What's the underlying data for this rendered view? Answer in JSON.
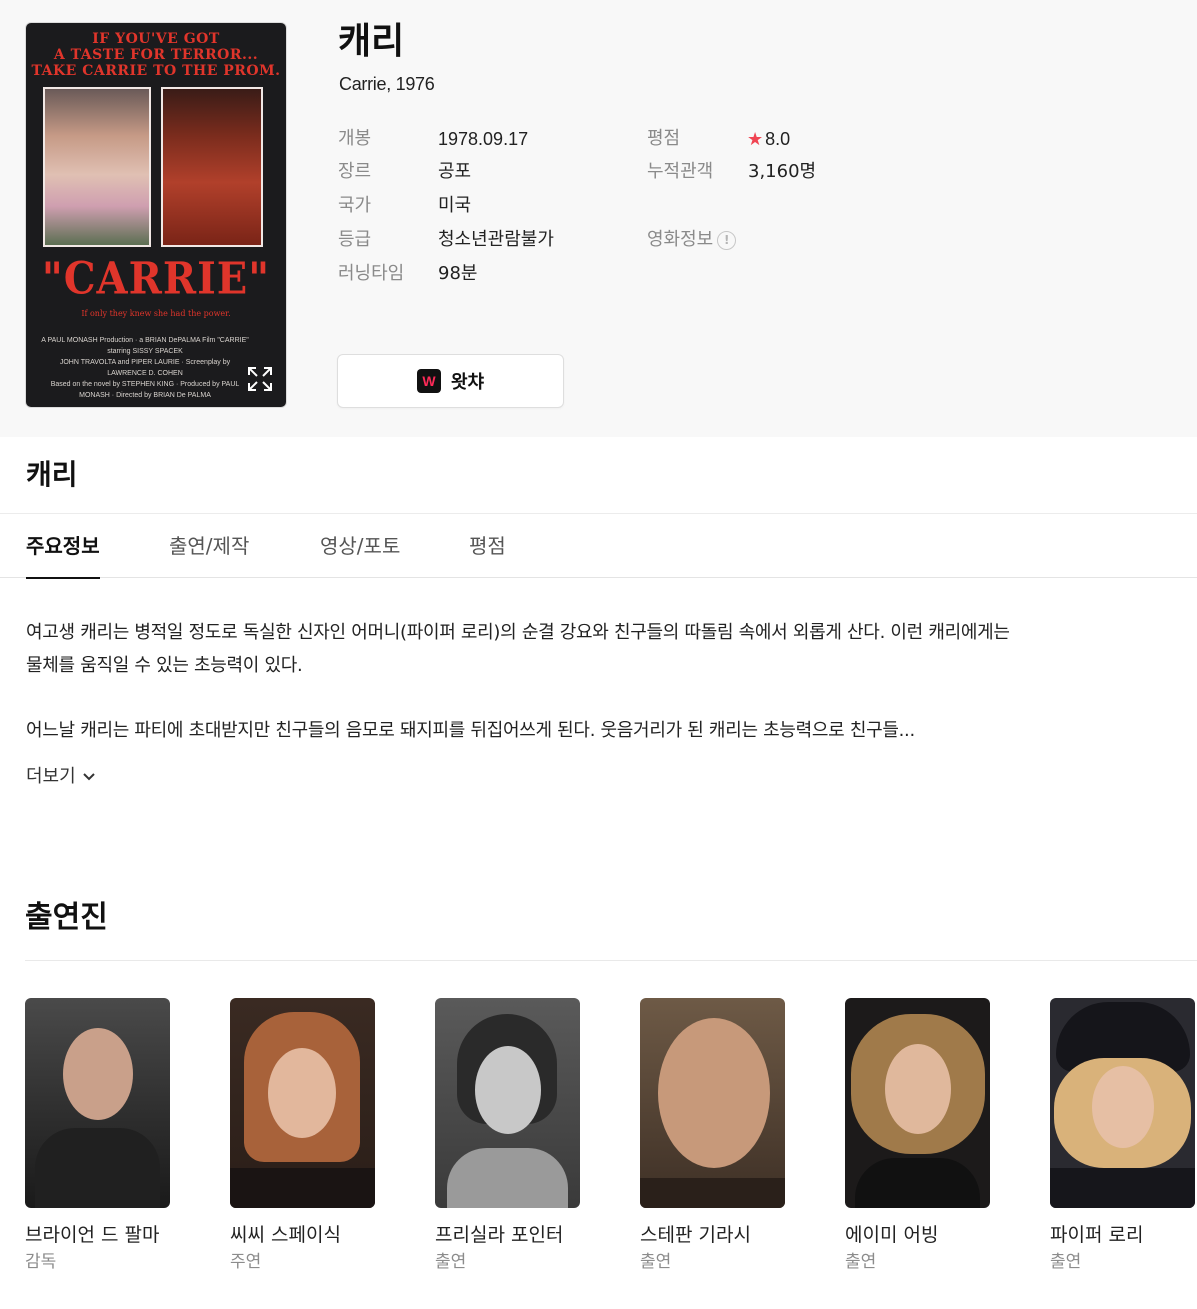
{
  "poster": {
    "tagline": "IF YOU'VE GOT\nA TASTE FOR TERROR...\nTAKE CARRIE TO THE PROM.",
    "title": "\"CARRIE\"",
    "subline": "If only they knew she had the power.",
    "credits": "A PAUL MONASH Production · a BRIAN DePALMA Film \"CARRIE\"\nstarring SISSY SPACEK\nJOHN TRAVOLTA and PIPER LAURIE · Screenplay by LAWRENCE D. COHEN\nBased on the novel by STEPHEN KING · Produced by PAUL MONASH · Directed by BRIAN De PALMA"
  },
  "movie": {
    "title": "캐리",
    "subtitle": "Carrie, 1976"
  },
  "info": {
    "release_label": "개봉",
    "release_value": "1978.09.17",
    "genre_label": "장르",
    "genre_value": "공포",
    "country_label": "국가",
    "country_value": "미국",
    "grade_label": "등급",
    "grade_value": "청소년관람불가",
    "runtime_label": "러닝타임",
    "runtime_value": "98분",
    "rating_label": "평점",
    "rating_value": "8.0",
    "audience_label": "누적관객",
    "audience_value": "3,160명",
    "movie_info_label": "영화정보"
  },
  "watcha": {
    "logo": "W",
    "label": "왓챠"
  },
  "section_title": "캐리",
  "tabs": [
    "주요정보",
    "출연/제작",
    "영상/포토",
    "평점"
  ],
  "synopsis": {
    "p1": "여고생 캐리는 병적일 정도로 독실한 신자인 어머니(파이퍼 로리)의 순결 강요와 친구들의 따돌림 속에서 외롭게 산다. 이런 캐리에게는 물체를 움직일 수 있는 초능력이 있다.",
    "p2": "어느날 캐리는 파티에 초대받지만 친구들의 음모로 돼지피를 뒤집어쓰게 된다. 웃음거리가 된 캐리는 초능력으로 친구들...",
    "more_label": "더보기"
  },
  "cast_heading": "출연진",
  "cast": [
    {
      "name": "브라이언 드 팔마",
      "role": "감독"
    },
    {
      "name": "씨씨 스페이식",
      "role": "주연"
    },
    {
      "name": "프리실라 포인터",
      "role": "출연"
    },
    {
      "name": "스테판 기라시",
      "role": "출연"
    },
    {
      "name": "에이미 어빙",
      "role": "출연"
    },
    {
      "name": "파이퍼 로리",
      "role": "출연"
    }
  ],
  "colors": {
    "rating_star": "#f04452",
    "watcha_brand": "#ff2a58",
    "poster_red": "#e0352b"
  }
}
